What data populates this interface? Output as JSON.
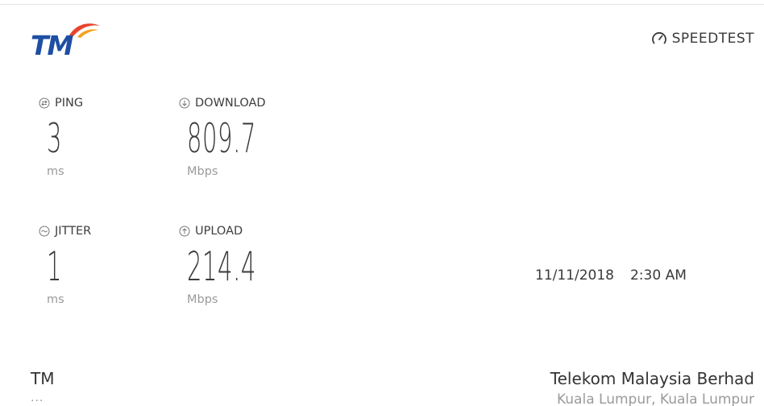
{
  "header": {
    "logo_text": "TM",
    "brand": "SPEEDTEST",
    "brand_icon": "speedometer-icon"
  },
  "metrics": {
    "ping": {
      "label": "PING",
      "value": "3",
      "unit": "ms",
      "icon": "ping-icon"
    },
    "download": {
      "label": "DOWNLOAD",
      "value": "809.7",
      "unit": "Mbps",
      "icon": "download-arrow-icon"
    },
    "jitter": {
      "label": "JITTER",
      "value": "1",
      "unit": "ms",
      "icon": "jitter-icon"
    },
    "upload": {
      "label": "UPLOAD",
      "value": "214.4",
      "unit": "Mbps",
      "icon": "upload-arrow-icon"
    }
  },
  "timestamp": {
    "date": "11/11/2018",
    "time": "2:30 AM"
  },
  "footer": {
    "isp_name": "TM",
    "isp_sub": "...",
    "server_name": "Telekom Malaysia Berhad",
    "server_location": "Kuala Lumpur, Kuala Lumpur"
  },
  "colors": {
    "logo_blue": "#1e4fa3",
    "logo_red": "#e8442c",
    "logo_orange": "#f5a020"
  }
}
